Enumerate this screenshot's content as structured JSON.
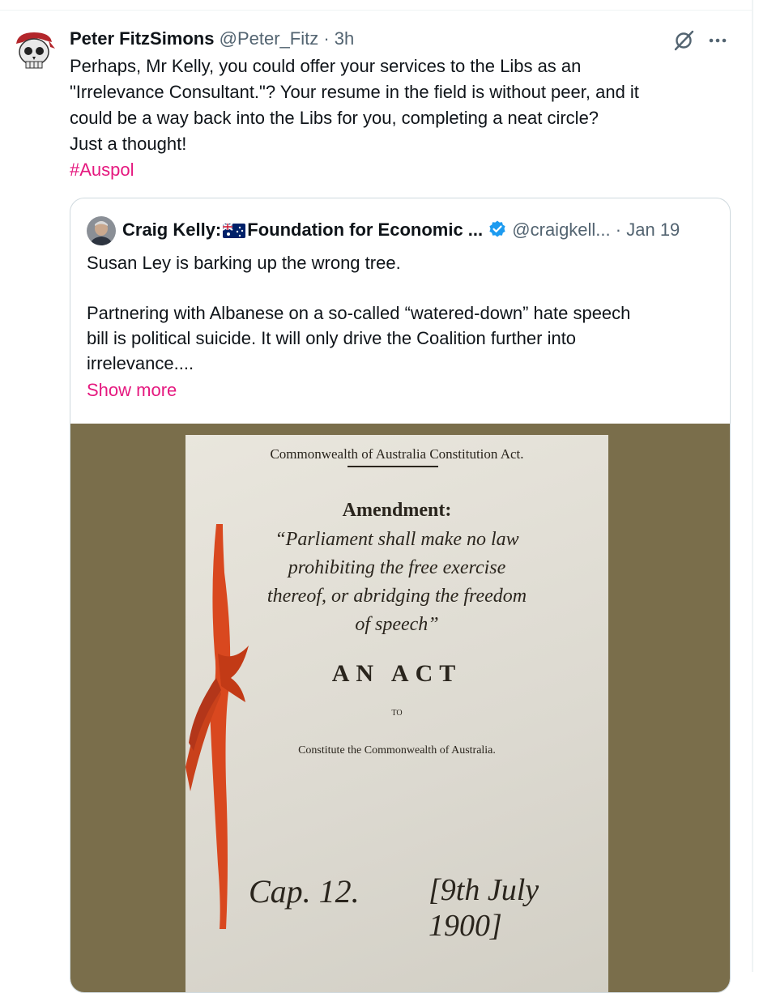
{
  "post": {
    "author_name": "Peter FitzSimons",
    "handle": "@Peter_Fitz",
    "separator": "·",
    "time": "3h",
    "text_lines": [
      "Perhaps, Mr Kelly, you could offer your services to the Libs as an",
      "\"Irrelevance Consultant.\"? Your resume in the field is without peer, and it",
      "could be a way back into the Libs for you, completing a neat circle?",
      "Just a thought!"
    ],
    "hashtag": "#Auspol",
    "actions": {
      "grok_icon": "grok-icon",
      "more_icon": "more-icon"
    }
  },
  "quoted": {
    "name_prefix": "Craig Kelly:",
    "flag_icon": "australia-flag-icon",
    "name_rest": "Foundation for Economic ...",
    "verified_icon": "verified-badge-icon",
    "handle": "@craigkell...",
    "separator": "·",
    "date": "Jan 19",
    "text_lines": [
      "Susan Ley is barking up the wrong tree.",
      "",
      "Partnering with Albanese on a so-called “watered-down” hate speech",
      "bill is political suicide. It will only drive the Coalition further into",
      "irrelevance...."
    ],
    "show_more": "Show more",
    "image": {
      "title": "Commonwealth of Australia Constitution Act.",
      "amendment_label": "Amendment:",
      "quote_lines": [
        "“Parliament shall make no law",
        "prohibiting the free exercise",
        "thereof, or abridging the freedom",
        "of speech”"
      ],
      "act": "AN ACT",
      "to": "TO",
      "constitute": "Constitute the Commonwealth of Australia.",
      "cap": "Cap. 12.",
      "date": "[9th July 1900]"
    }
  },
  "colors": {
    "accent": "#e5197f",
    "muted": "#536471",
    "verified": "#1d9bf0",
    "image_bg": "#7a6e4b"
  }
}
